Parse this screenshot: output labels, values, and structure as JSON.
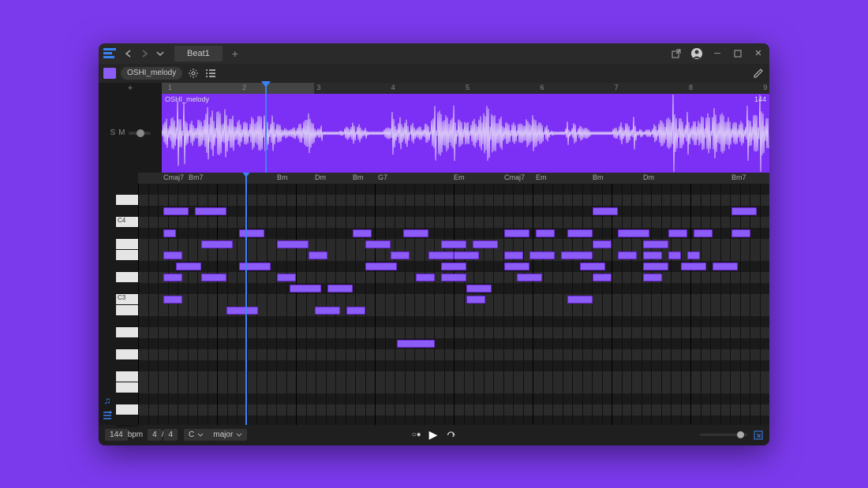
{
  "titlebar": {
    "tab_name": "Beat1"
  },
  "subbar": {
    "clip_name": "OSHI_melody"
  },
  "track": {
    "solo": "S",
    "mute": "M",
    "add": "+"
  },
  "ruler": {
    "marks": [
      "1",
      "2",
      "3",
      "4",
      "5",
      "6",
      "7",
      "8",
      "9"
    ],
    "active_bars": 2,
    "playhead_pct": 17
  },
  "clip": {
    "label": "OSHI_melody",
    "badge": "144"
  },
  "chords": [
    {
      "pos": 4,
      "label": "Cmaj7"
    },
    {
      "pos": 8,
      "label": "Bm7"
    },
    {
      "pos": 22,
      "label": "Bm"
    },
    {
      "pos": 28,
      "label": "Dm"
    },
    {
      "pos": 34,
      "label": "Bm"
    },
    {
      "pos": 38,
      "label": "G7"
    },
    {
      "pos": 50,
      "label": "Em"
    },
    {
      "pos": 58,
      "label": "Cmaj7"
    },
    {
      "pos": 63,
      "label": "Em"
    },
    {
      "pos": 72,
      "label": "Bm"
    },
    {
      "pos": 80,
      "label": "Dm"
    },
    {
      "pos": 94,
      "label": "Bm7"
    }
  ],
  "piano_labels": {
    "c4": "C4",
    "c3": "C3"
  },
  "notes": [
    {
      "row": 2,
      "start": 4,
      "len": 4
    },
    {
      "row": 2,
      "start": 9,
      "len": 5
    },
    {
      "row": 2,
      "start": 72,
      "len": 4
    },
    {
      "row": 2,
      "start": 94,
      "len": 4
    },
    {
      "row": 4,
      "start": 4,
      "len": 2
    },
    {
      "row": 4,
      "start": 16,
      "len": 4
    },
    {
      "row": 4,
      "start": 34,
      "len": 3
    },
    {
      "row": 4,
      "start": 42,
      "len": 4
    },
    {
      "row": 4,
      "start": 58,
      "len": 4
    },
    {
      "row": 4,
      "start": 63,
      "len": 3
    },
    {
      "row": 4,
      "start": 68,
      "len": 4
    },
    {
      "row": 4,
      "start": 76,
      "len": 5
    },
    {
      "row": 4,
      "start": 84,
      "len": 3
    },
    {
      "row": 4,
      "start": 88,
      "len": 3
    },
    {
      "row": 4,
      "start": 94,
      "len": 3
    },
    {
      "row": 5,
      "start": 10,
      "len": 5
    },
    {
      "row": 5,
      "start": 22,
      "len": 5
    },
    {
      "row": 5,
      "start": 36,
      "len": 4
    },
    {
      "row": 5,
      "start": 48,
      "len": 4
    },
    {
      "row": 5,
      "start": 53,
      "len": 4
    },
    {
      "row": 5,
      "start": 72,
      "len": 3
    },
    {
      "row": 5,
      "start": 80,
      "len": 4
    },
    {
      "row": 6,
      "start": 4,
      "len": 3
    },
    {
      "row": 6,
      "start": 27,
      "len": 3
    },
    {
      "row": 6,
      "start": 40,
      "len": 3
    },
    {
      "row": 6,
      "start": 46,
      "len": 4
    },
    {
      "row": 6,
      "start": 50,
      "len": 4
    },
    {
      "row": 6,
      "start": 58,
      "len": 3
    },
    {
      "row": 6,
      "start": 62,
      "len": 4
    },
    {
      "row": 6,
      "start": 67,
      "len": 5
    },
    {
      "row": 6,
      "start": 76,
      "len": 3
    },
    {
      "row": 6,
      "start": 80,
      "len": 3
    },
    {
      "row": 6,
      "start": 84,
      "len": 2
    },
    {
      "row": 6,
      "start": 87,
      "len": 2
    },
    {
      "row": 7,
      "start": 6,
      "len": 4
    },
    {
      "row": 7,
      "start": 16,
      "len": 5
    },
    {
      "row": 7,
      "start": 36,
      "len": 5
    },
    {
      "row": 7,
      "start": 48,
      "len": 4
    },
    {
      "row": 7,
      "start": 58,
      "len": 4
    },
    {
      "row": 7,
      "start": 70,
      "len": 4
    },
    {
      "row": 7,
      "start": 80,
      "len": 4
    },
    {
      "row": 7,
      "start": 86,
      "len": 4
    },
    {
      "row": 7,
      "start": 91,
      "len": 4
    },
    {
      "row": 8,
      "start": 4,
      "len": 3
    },
    {
      "row": 8,
      "start": 10,
      "len": 4
    },
    {
      "row": 8,
      "start": 22,
      "len": 3
    },
    {
      "row": 8,
      "start": 44,
      "len": 3
    },
    {
      "row": 8,
      "start": 48,
      "len": 4
    },
    {
      "row": 8,
      "start": 60,
      "len": 4
    },
    {
      "row": 8,
      "start": 72,
      "len": 3
    },
    {
      "row": 8,
      "start": 80,
      "len": 3
    },
    {
      "row": 9,
      "start": 24,
      "len": 5
    },
    {
      "row": 9,
      "start": 30,
      "len": 4
    },
    {
      "row": 9,
      "start": 52,
      "len": 4
    },
    {
      "row": 10,
      "start": 4,
      "len": 3
    },
    {
      "row": 10,
      "start": 52,
      "len": 3
    },
    {
      "row": 10,
      "start": 68,
      "len": 4
    },
    {
      "row": 11,
      "start": 14,
      "len": 5
    },
    {
      "row": 11,
      "start": 28,
      "len": 4
    },
    {
      "row": 11,
      "start": 33,
      "len": 3
    },
    {
      "row": 14,
      "start": 41,
      "len": 6
    }
  ],
  "transport": {
    "bpm_value": "144",
    "bpm_label": "bpm",
    "ts_num": "4",
    "ts_sep": "/",
    "ts_den": "4",
    "key": "C",
    "scale": "major"
  },
  "colors": {
    "accent": "#8b5cf6",
    "playhead": "#3b82f6"
  }
}
